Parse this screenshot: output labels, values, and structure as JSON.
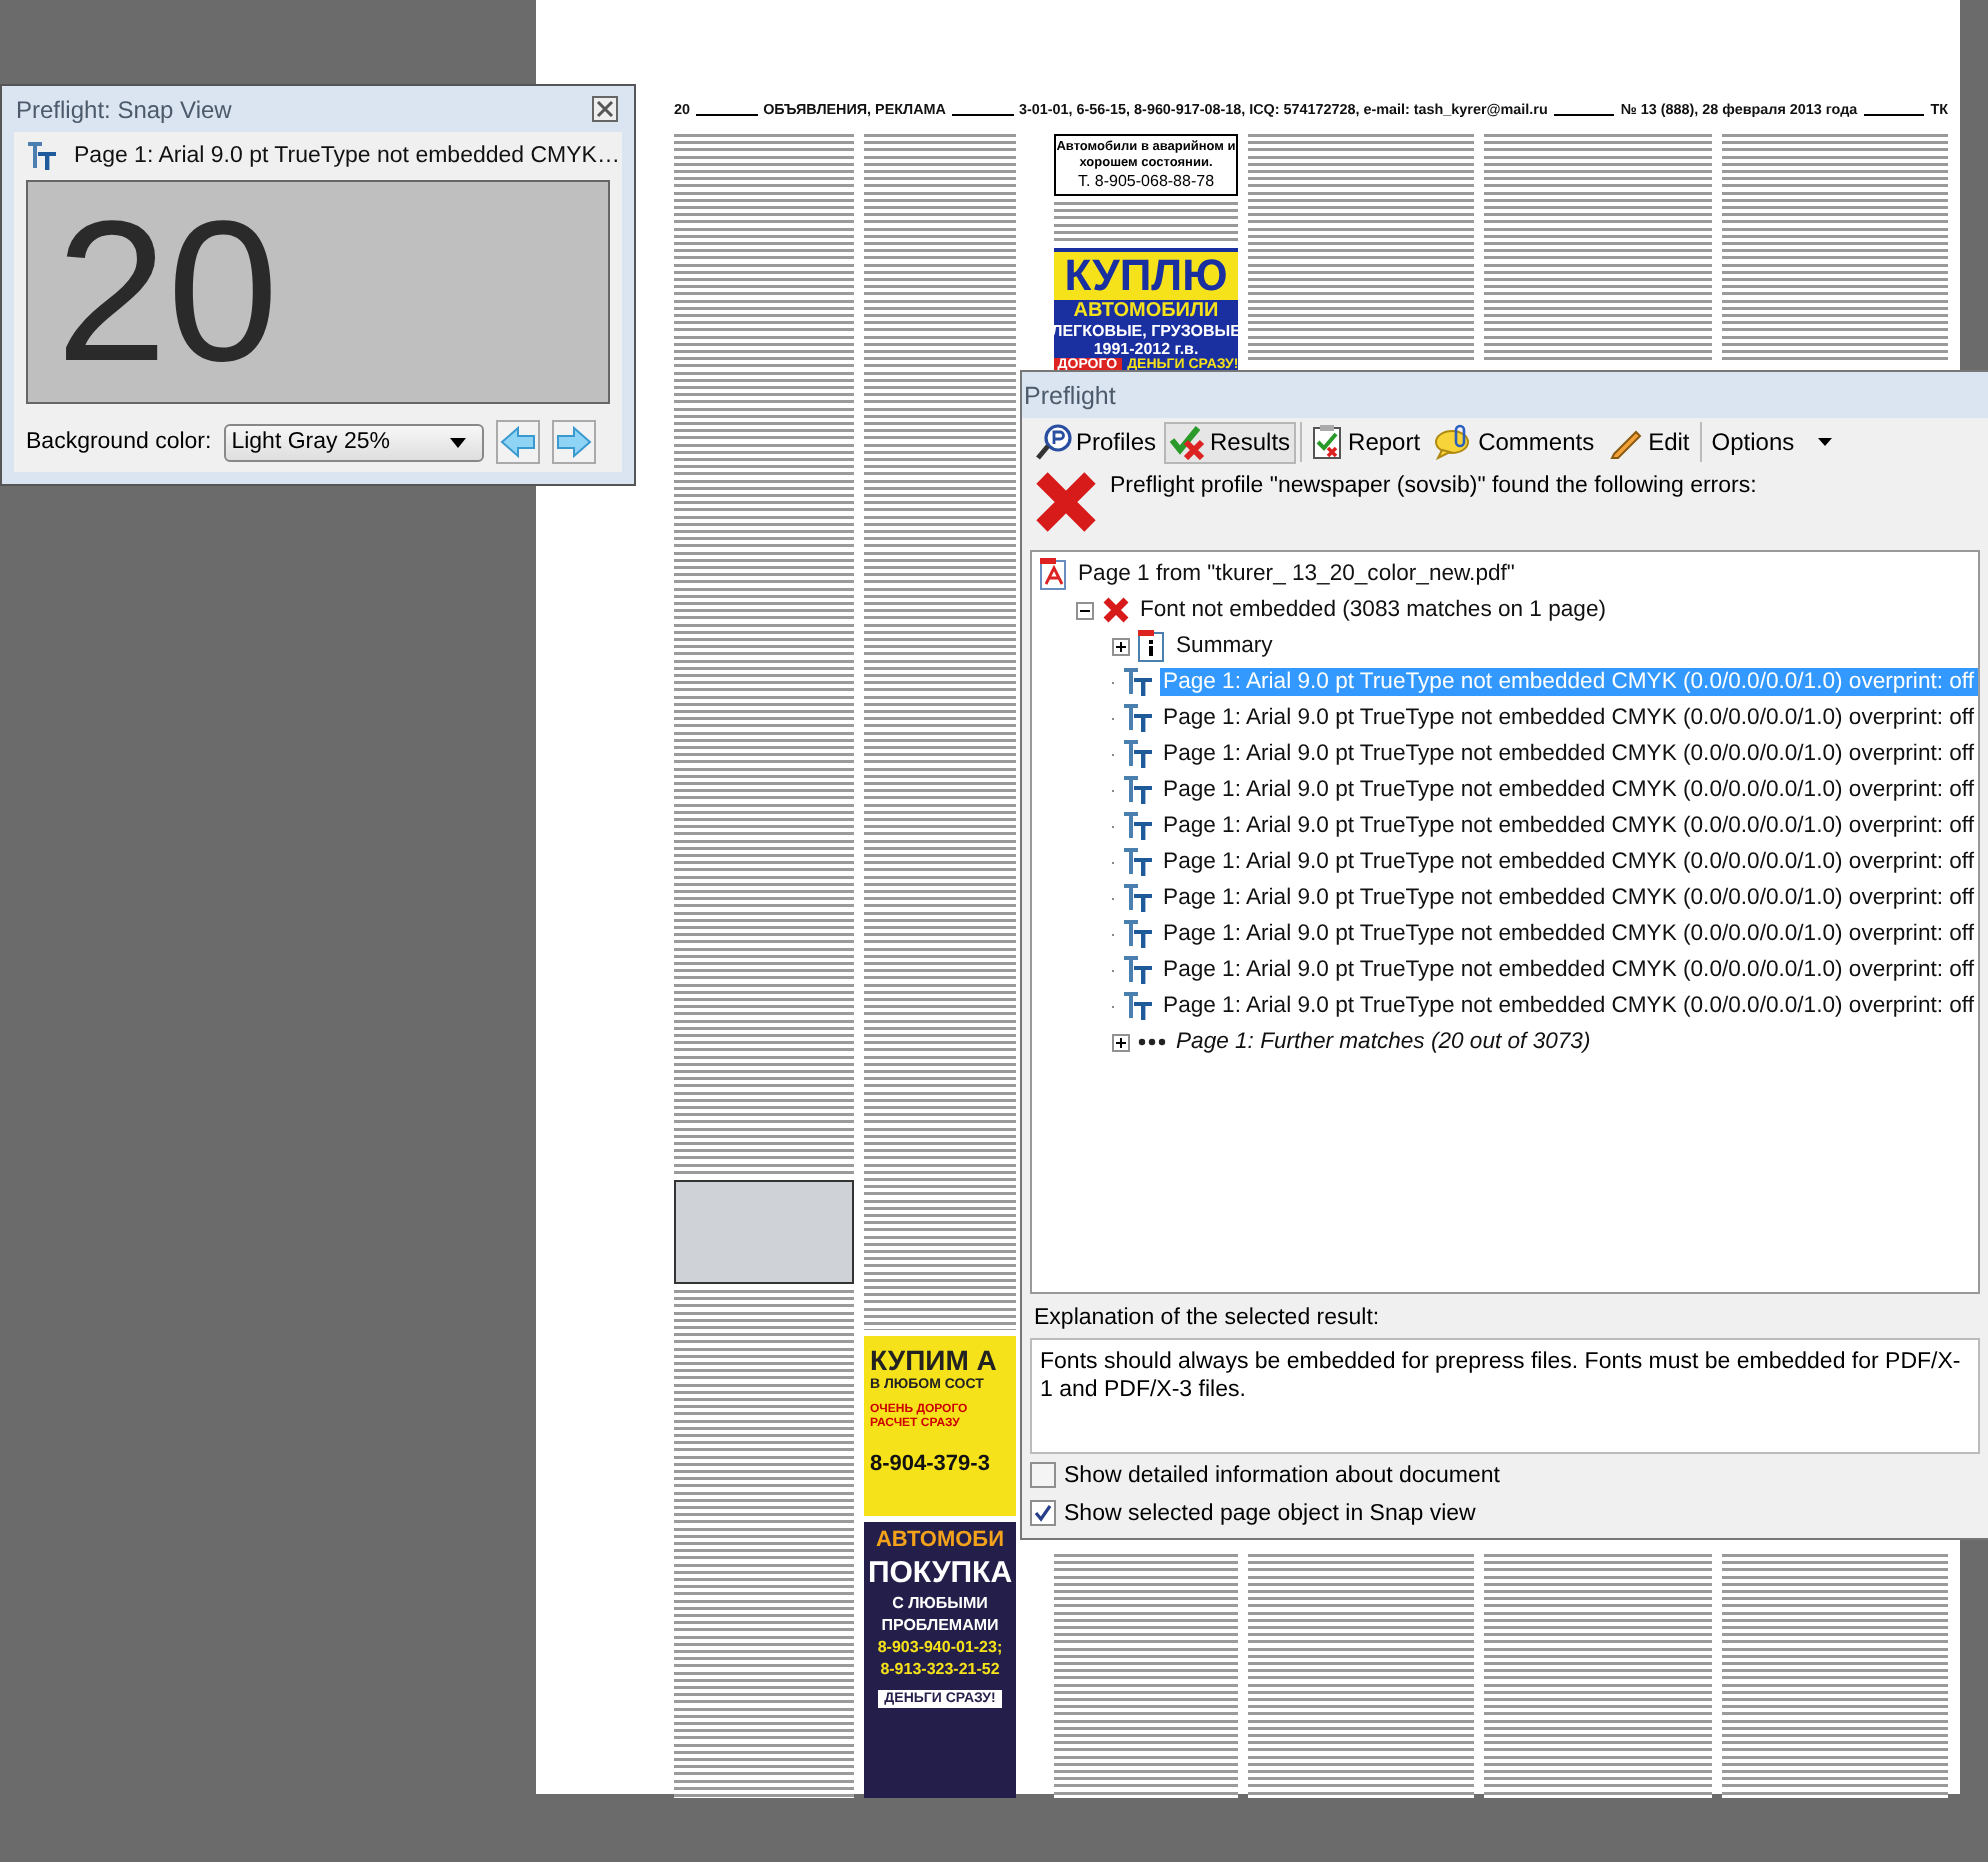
{
  "newspaper": {
    "header": [
      "20",
      "ОБЪЯВЛЕНИЯ, РЕКЛАМА",
      "3-01-01, 6-56-15, 8-960-917-08-18, ICQ: 574172728, e-mail: tash_kyrer@mail.ru",
      "№ 13 (888), 28 февраля 2013 года",
      "ТК"
    ],
    "boxed_ad": {
      "title": "Автомобили в аварийном и хорошем состоянии.",
      "phone": "Т. 8-905-068-88-78"
    },
    "blue_ad": {
      "headline": "КУПЛЮ",
      "line_1": "АВТОМОБИЛИ",
      "line_2": "ЛЕГКОВЫЕ, ГРУЗОВЫЕ",
      "years": "1991-2012 г.в.",
      "tag_1": "ДОРОГО",
      "tag_2": "ДЕНЬГИ СРАЗУ!"
    },
    "yellow_ad": {
      "headline": "КУПИМ А",
      "line": "В ЛЮБОМ СОСТ",
      "badge": "ОЧЕНЬ ДОРОГО РАСЧЕТ СРАЗУ",
      "phone": "8-904-379-3"
    },
    "dark_ad": {
      "headline": "АВТОМОБИ",
      "title": "ПОКУПКА",
      "line_1": "С ЛЮБЫМИ",
      "line_2": "ПРОБЛЕМАМИ",
      "phone_1": "8-903-940-01-23;",
      "phone_2": "8-913-323-21-52",
      "tag": "ДЕНЬГИ СРАЗУ!"
    }
  },
  "snap_view": {
    "title": "Preflight: Snap View",
    "object_label": "Page 1: Arial 9.0 pt TrueType not embedded CMYK…",
    "preview_text": "20",
    "background_label": "Background color:",
    "background_value": "Light Gray 25%"
  },
  "preflight": {
    "title": "Preflight",
    "tabs": [
      {
        "label": "Profiles",
        "kind": "profiles",
        "selected": false
      },
      {
        "label": "Results",
        "kind": "results",
        "selected": true
      },
      {
        "label": "Report",
        "kind": "report",
        "selected": false
      },
      {
        "label": "Comments",
        "kind": "comments",
        "selected": false
      },
      {
        "label": "Edit",
        "kind": "edit",
        "selected": false
      },
      {
        "label": "Options",
        "kind": "options",
        "selected": false
      }
    ],
    "message": "Preflight profile \"newspaper (sovsib)\" found the following errors:",
    "tree": [
      {
        "label": "Page 1 from \"tkurer_ 13_20_color_new.pdf\"",
        "kind": "pdf",
        "selected": false,
        "children": [
          {
            "label": "Font not embedded (3083 matches on 1 page)",
            "kind": "error",
            "selected": false,
            "expanded": true,
            "children": [
              {
                "label": "Summary",
                "kind": "summary",
                "selected": false,
                "expanded": false
              },
              {
                "label": "Page 1: Arial 9.0 pt TrueType not embedded CMYK (0.0/0.0/0.0/1.0)  overprint: off",
                "kind": "font",
                "selected": true
              },
              {
                "label": "Page 1: Arial 9.0 pt TrueType not embedded CMYK (0.0/0.0/0.0/1.0)  overprint: off",
                "kind": "font",
                "selected": false
              },
              {
                "label": "Page 1: Arial 9.0 pt TrueType not embedded CMYK (0.0/0.0/0.0/1.0)  overprint: off",
                "kind": "font",
                "selected": false
              },
              {
                "label": "Page 1: Arial 9.0 pt TrueType not embedded CMYK (0.0/0.0/0.0/1.0)  overprint: off",
                "kind": "font",
                "selected": false
              },
              {
                "label": "Page 1: Arial 9.0 pt TrueType not embedded CMYK (0.0/0.0/0.0/1.0)  overprint: off",
                "kind": "font",
                "selected": false
              },
              {
                "label": "Page 1: Arial 9.0 pt TrueType not embedded CMYK (0.0/0.0/0.0/1.0)  overprint: off",
                "kind": "font",
                "selected": false
              },
              {
                "label": "Page 1: Arial 9.0 pt TrueType not embedded CMYK (0.0/0.0/0.0/1.0)  overprint: off",
                "kind": "font",
                "selected": false
              },
              {
                "label": "Page 1: Arial 9.0 pt TrueType not embedded CMYK (0.0/0.0/0.0/1.0)  overprint: off",
                "kind": "font",
                "selected": false
              },
              {
                "label": "Page 1: Arial 9.0 pt TrueType not embedded CMYK (0.0/0.0/0.0/1.0)  overprint: off",
                "kind": "font",
                "selected": false
              },
              {
                "label": "Page 1: Arial 9.0 pt TrueType not embedded CMYK (0.0/0.0/0.0/1.0)  overprint: off",
                "kind": "font",
                "selected": false
              },
              {
                "label": "Page 1: Further matches (20 out of 3073)",
                "kind": "more",
                "selected": false,
                "expanded": false
              }
            ]
          }
        ]
      }
    ],
    "explanation_label": "Explanation of the selected result:",
    "explanation": "Fonts should always be embedded for prepress files. Fonts must be embedded for PDF/X-1 and PDF/X-3 files.",
    "options": [
      {
        "label": "Show detailed information about document",
        "checked": false
      },
      {
        "label": "Show selected page object in Snap view",
        "checked": true
      }
    ]
  }
}
